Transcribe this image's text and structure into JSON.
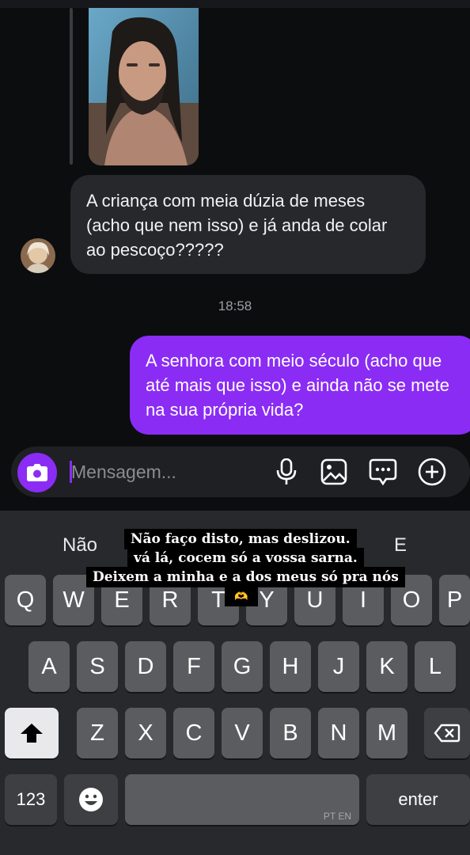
{
  "chat": {
    "incoming_message": "A criança com meia dúzia de meses (acho que nem isso) e já anda de colar ao pescoço?????",
    "timestamp": "18:58",
    "outgoing_message": "A senhora com meio século (acho que até mais que isso) e ainda não se mete na sua própria vida?"
  },
  "composer": {
    "placeholder": "Mensagem...",
    "icons": [
      "camera-icon",
      "microphone-icon",
      "image-icon",
      "sticker-icon",
      "plus-icon"
    ],
    "accent_color": "#8b2cf5"
  },
  "keyboard": {
    "suggestions": [
      "Não",
      "E"
    ],
    "row1": [
      "Q",
      "W",
      "E",
      "R",
      "T",
      "Y",
      "U",
      "I",
      "O",
      "P"
    ],
    "row2": [
      "A",
      "S",
      "D",
      "F",
      "G",
      "H",
      "J",
      "K",
      "L"
    ],
    "row3": [
      "Z",
      "X",
      "C",
      "V",
      "B",
      "N",
      "M"
    ],
    "numbers_label": "123",
    "enter_label": "enter",
    "language_label": "PT EN"
  },
  "overlay": {
    "lines": [
      "Não faço disto, mas deslizou.",
      "vá lá, cocem só a vossa sarna.",
      "Deixem a minha e a dos meus só pra nós"
    ],
    "emoji": "🫶"
  }
}
